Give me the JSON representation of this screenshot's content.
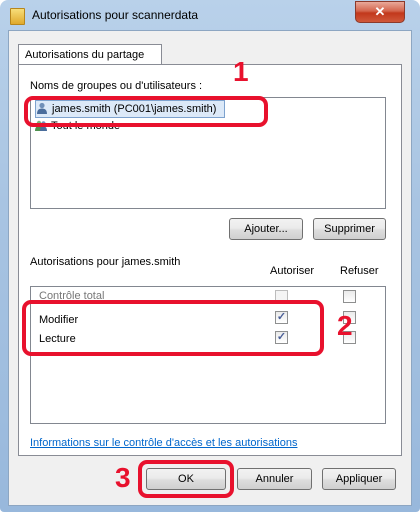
{
  "window": {
    "title": "Autorisations pour scannerdata",
    "close_glyph": "✕"
  },
  "tab": {
    "label": "Autorisations du partage"
  },
  "users": {
    "label": "Noms de groupes ou d'utilisateurs :",
    "items": [
      {
        "name": "james.smith (PC001\\james.smith)",
        "icon": "user-icon",
        "selected": true
      },
      {
        "name": "Tout le monde",
        "icon": "group-icon",
        "selected": false
      }
    ],
    "add_label": "Ajouter...",
    "remove_label": "Supprimer"
  },
  "permissions": {
    "label": "Autorisations pour james.smith",
    "col_allow": "Autoriser",
    "col_deny": "Refuser",
    "rows": [
      {
        "name": "Contrôle total",
        "allow": false,
        "deny": false
      },
      {
        "name": "Modifier",
        "allow": true,
        "deny": false
      },
      {
        "name": "Lecture",
        "allow": true,
        "deny": false
      }
    ]
  },
  "info_link": "Informations sur le contrôle d'accès et les autorisations",
  "footer": {
    "ok_label": "OK",
    "cancel_label": "Annuler",
    "apply_label": "Appliquer"
  },
  "callouts": [
    "1",
    "2",
    "3"
  ],
  "colors": {
    "callout": "#e8112d",
    "link": "#0066cc"
  }
}
